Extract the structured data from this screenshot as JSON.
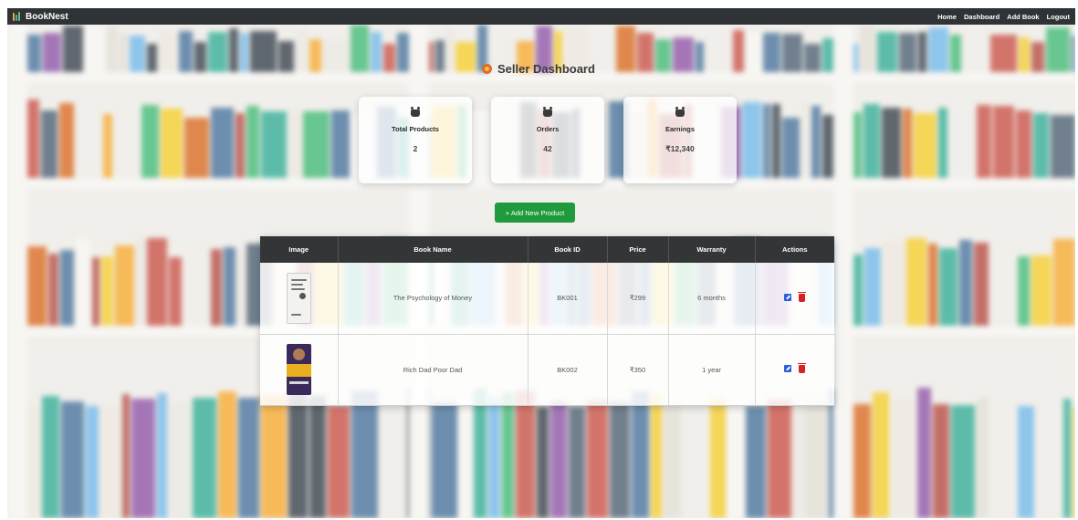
{
  "navbar": {
    "brand": "BookNest",
    "links": [
      "Home",
      "Dashboard",
      "Add Book",
      "Logout"
    ]
  },
  "dashboard": {
    "title": "Seller Dashboard",
    "cards": [
      {
        "title": "Total Products",
        "value": "2",
        "icon": "bag-icon"
      },
      {
        "title": "Orders",
        "value": "42",
        "icon": "bag-icon"
      },
      {
        "title": "Earnings",
        "value": "₹12,340",
        "icon": "bag-icon"
      }
    ],
    "add_button": "+ Add New Product"
  },
  "table": {
    "headers": [
      "Image",
      "Book Name",
      "Book ID",
      "Price",
      "Warranty",
      "Actions"
    ],
    "rows": [
      {
        "name": "The Psychology of Money",
        "id": "BK001",
        "price": "₹299",
        "warranty": "6 months"
      },
      {
        "name": "Rich Dad Poor Dad",
        "id": "BK002",
        "price": "₹350",
        "warranty": "1 year"
      }
    ]
  },
  "colors": {
    "navbar": "#2f3336",
    "table_header": "#333536",
    "add_button": "#1f9b3d",
    "edit": "#2b5fd9",
    "delete": "#d91e27"
  }
}
